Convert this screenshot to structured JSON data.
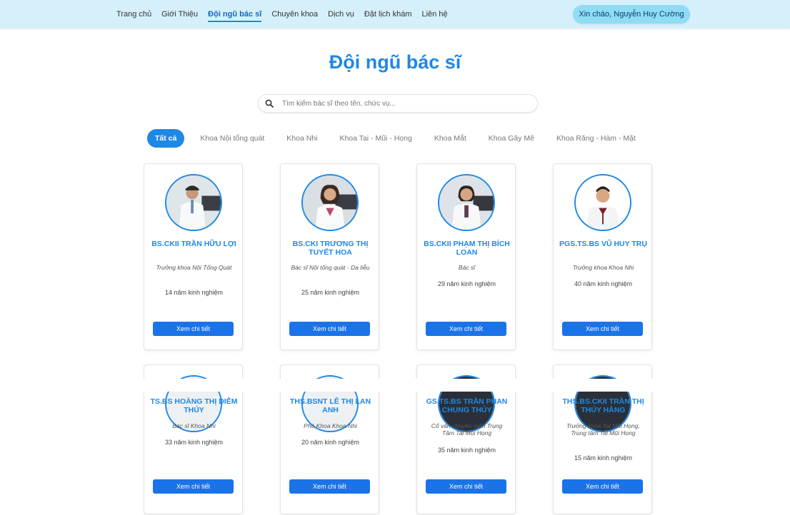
{
  "nav": {
    "items": [
      "Trang chủ",
      "Giới Thiệu",
      "Đội ngũ bác sĩ",
      "Chuyên khoa",
      "Dịch vụ",
      "Đặt lịch khám",
      "Liên hệ"
    ],
    "active_index": 2,
    "greeting": "Xin chào, Nguyễn Huy Cường"
  },
  "page": {
    "title": "Đội ngũ bác sĩ"
  },
  "search": {
    "placeholder": "Tìm kiếm bác sĩ theo tên, chức vụ..."
  },
  "tabs": [
    "Tất cả",
    "Khoa Nội tổng quát",
    "Khoa Nhi",
    "Khoa Tai - Mũi - Họng",
    "Khoa Mắt",
    "Khoa Gây Mê",
    "Khoa Răng - Hàm - Mặt"
  ],
  "active_tab": 0,
  "button_label": "Xem chi tiết",
  "doctors": [
    {
      "name": "BS.CKII TRẦN HỮU LỢI",
      "role": "Trưởng khoa Nội Tổng Quát",
      "experience": "14 năm kinh nghiệm"
    },
    {
      "name": "BS.CKI TRƯƠNG THỊ TUYẾT HOA",
      "role": "Bác sĩ Nội tổng quát - Da liễu",
      "experience": "25 năm kinh nghiệm"
    },
    {
      "name": "BS.CKII PHẠM THỊ BÍCH LOAN",
      "role": "Bác sĩ",
      "experience": "29 năm kinh nghiệm"
    },
    {
      "name": "PGS.TS.BS VŨ HUY TRỤ",
      "role": "Trưởng khoa Khoa Nhi",
      "experience": "40 năm kinh nghiệm"
    },
    {
      "name": "TS.BS HOÀNG THỊ DIỄM THÚY",
      "role": "Bác sĩ Khoa Nhi",
      "experience": "33 năm kinh nghiệm"
    },
    {
      "name": "ThS.BSNT LÊ THỊ LAN ANH",
      "role": "Phó Khoa Khoa Nhi",
      "experience": "20 năm kinh nghiệm"
    },
    {
      "name": "GS.TS.BS TRẦN PHAN CHUNG THỦY",
      "role": "Cố vấn chuyên môn Trung Tâm Tai Mũi Họng",
      "experience": "35 năm kinh nghiệm"
    },
    {
      "name": "ThS.BS.CKII TRẦN THỊ THÚY HẰNG",
      "role": "Trưởng khoa Tai Mũi Họng, Trung tâm Tai Mũi Họng",
      "experience": "15 năm kinh nghiệm"
    }
  ],
  "colors": {
    "accent": "#1e88e5",
    "header_bg": "#d6f0fb",
    "greeting_bg": "#8fdcf5"
  }
}
